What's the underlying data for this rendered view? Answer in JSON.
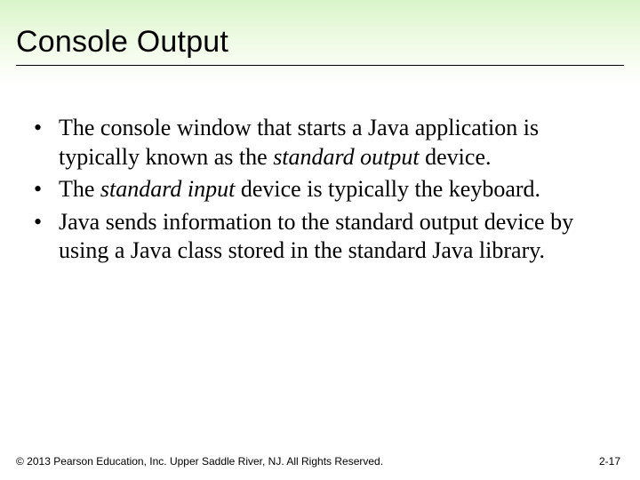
{
  "slide": {
    "title": "Console Output",
    "bullets": [
      {
        "pre": "The console window that starts a Java application is typically known as the ",
        "em": "standard output",
        "post": " device."
      },
      {
        "pre": "The ",
        "em": "standard input",
        "post": " device is typically the keyboard."
      },
      {
        "pre": "Java sends information to the standard output device by using a Java class stored in the standard Java library.",
        "em": "",
        "post": ""
      }
    ],
    "footer": "© 2013 Pearson Education, Inc. Upper Saddle River, NJ. All Rights Reserved.",
    "page": "2-17"
  }
}
